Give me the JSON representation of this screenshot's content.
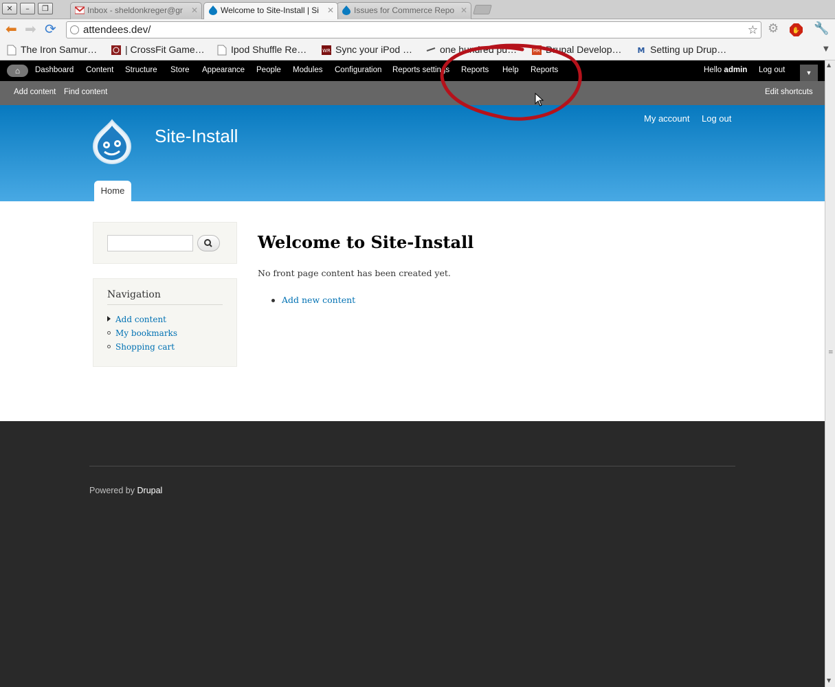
{
  "browser": {
    "tabs": [
      {
        "title": "Inbox - sheldonkreger@gr",
        "icon": "gmail-icon",
        "active": false
      },
      {
        "title": "Welcome to Site-Install | Si",
        "icon": "drupal-drop-icon",
        "active": true
      },
      {
        "title": "Issues for Commerce Repo",
        "icon": "drupal-drop-icon",
        "active": false
      }
    ],
    "url": "attendees.dev/",
    "bookmarks": [
      {
        "label": "The Iron Samur…",
        "icon": "page-icon"
      },
      {
        "label": "| CrossFit Game…",
        "icon": "crossfit-icon"
      },
      {
        "label": "Ipod Shuffle Re…",
        "icon": "page-icon"
      },
      {
        "label": "Sync your iPod …",
        "icon": "wr-icon"
      },
      {
        "label": "one hundred pu…",
        "icon": "arrow-icon"
      },
      {
        "label": "Drupal Develop…",
        "icon": "hr-icon"
      },
      {
        "label": "Setting up Drup…",
        "icon": "m-icon"
      }
    ]
  },
  "admin_toolbar": {
    "items": [
      "Dashboard",
      "Content",
      "Structure",
      "Store",
      "Appearance",
      "People",
      "Modules",
      "Configuration",
      "Reports settings",
      "Reports",
      "Help",
      "Reports"
    ],
    "hello": "Hello",
    "user": "admin",
    "logout": "Log out"
  },
  "shortcuts": {
    "items": [
      "Add content",
      "Find content"
    ],
    "edit": "Edit shortcuts"
  },
  "header": {
    "site_name": "Site-Install",
    "secondary_menu": [
      "My account",
      "Log out"
    ],
    "main_tab": "Home"
  },
  "sidebar": {
    "nav_title": "Navigation",
    "nav_items": [
      "Add content",
      "My bookmarks",
      "Shopping cart"
    ]
  },
  "content": {
    "title": "Welcome to Site-Install",
    "text": "No front page content has been created yet.",
    "link": "Add new content"
  },
  "footer": {
    "powered_by": "Powered by",
    "link": "Drupal"
  },
  "colors": {
    "header_top": "#0779bf",
    "header_bottom": "#48a9e4",
    "annotation": "#b5121b",
    "link": "#0071b3"
  }
}
